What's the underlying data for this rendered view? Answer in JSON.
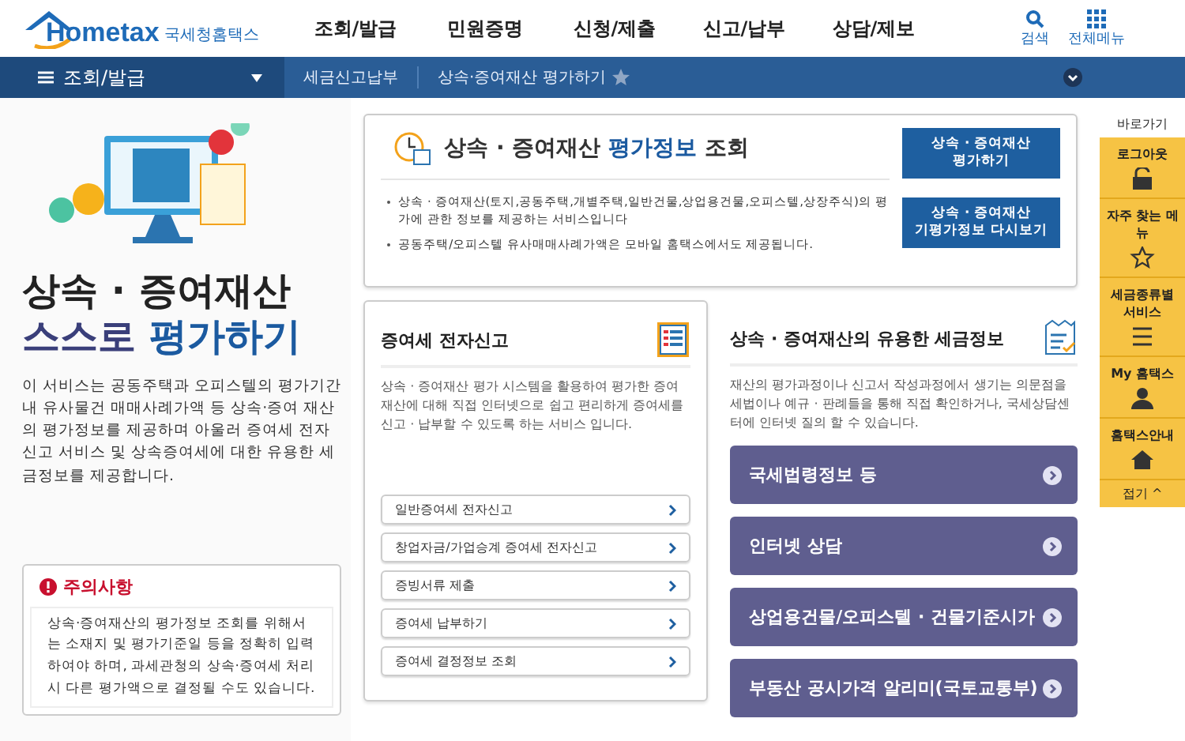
{
  "header": {
    "logo": "Hometax",
    "logo_sub": "국세청홈택스",
    "menu": [
      "조회/발급",
      "민원증명",
      "신청/제출",
      "신고/납부",
      "상담/제보"
    ],
    "tools": [
      {
        "kind": "search",
        "label": "검색"
      },
      {
        "kind": "grid",
        "label": "전체메뉴"
      }
    ]
  },
  "breadcrumb": {
    "menu_label": "조회/발급",
    "items": [
      "세금신고납부",
      "상속·증여재산 평가하기"
    ],
    "favorite": false
  },
  "intro": {
    "title_line1": "상속 · 증여재산",
    "title_line2a": "스스로",
    "title_line2b": "평가하기",
    "text": "이 서비스는 공동주택과 오피스텔의 평가기간 내 유사물건 매매사례가액 등 상속·증여 재산의 평가정보를 제공하며 아울러 증여세 전자신고 서비스 및 상속증여세에 대한 유용한 세금정보를 제공합니다."
  },
  "notice": {
    "title": "주의사항",
    "text": "상속·증여재산의 평가정보 조회를 위해서는 소재지 및 평가기준일 등을 정확히 입력하여야 하며, 과세관청의 상속·증여세 처리시 다른 평가액으로 결정될 수도 있습니다."
  },
  "lookup": {
    "title_a": "상속 · 증여재산",
    "title_b": "평가정보",
    "title_c": "조회",
    "bullets": [
      "상속 · 증여재산(토지,공동주택,개별주택,일반건물,상업용건물,오피스텔,상장주식)의 평가에 관한 정보를 제공하는 서비스입니다",
      "공동주택/오피스텔 유사매매사례가액은 모바일 홈택스에서도 제공됩니다."
    ],
    "buttons": [
      "상속 · 증여재산\n평가하기",
      "상속 · 증여재산\n기평가정보 다시보기"
    ]
  },
  "efiling": {
    "title": "증여세 전자신고",
    "text": "상속 · 증여재산 평가 시스템을 활용하여 평가한 증여재산에 대해 직접 인터넷으로 쉽고 편리하게 증여세를 신고 · 납부할 수 있도록 하는 서비스 입니다.",
    "links": [
      "일반증여세 전자신고",
      "창업자금/가업승계 증여세 전자신고",
      "증빙서류 제출",
      "증여세 납부하기",
      "증여세 결정정보 조회"
    ]
  },
  "taxinfo": {
    "title": "상속 · 증여재산의 유용한 세금정보",
    "text": "재산의 평가과정이나 신고서 작성과정에서 생기는 의문점을 세법이나 예규 · 판례들을 통해 직접 확인하거나, 국세상담센터에 인터넷 질의 할 수 있습니다.",
    "links": [
      "국세법령정보 등",
      "인터넷 상담",
      "상업용건물/오피스텔 · 건물기준시가",
      "부동산 공시가격 알리미(국토교통부)"
    ]
  },
  "quick": {
    "title": "바로가기",
    "items": [
      {
        "kind": "lock",
        "label": "로그아웃"
      },
      {
        "kind": "star",
        "label": "자주 찾는 메뉴"
      },
      {
        "kind": "list",
        "label": "세금종류별 서비스"
      },
      {
        "kind": "person",
        "label": "My 홈택스"
      },
      {
        "kind": "house",
        "label": "홈택스안내"
      }
    ],
    "collapse": "접기 ^"
  }
}
